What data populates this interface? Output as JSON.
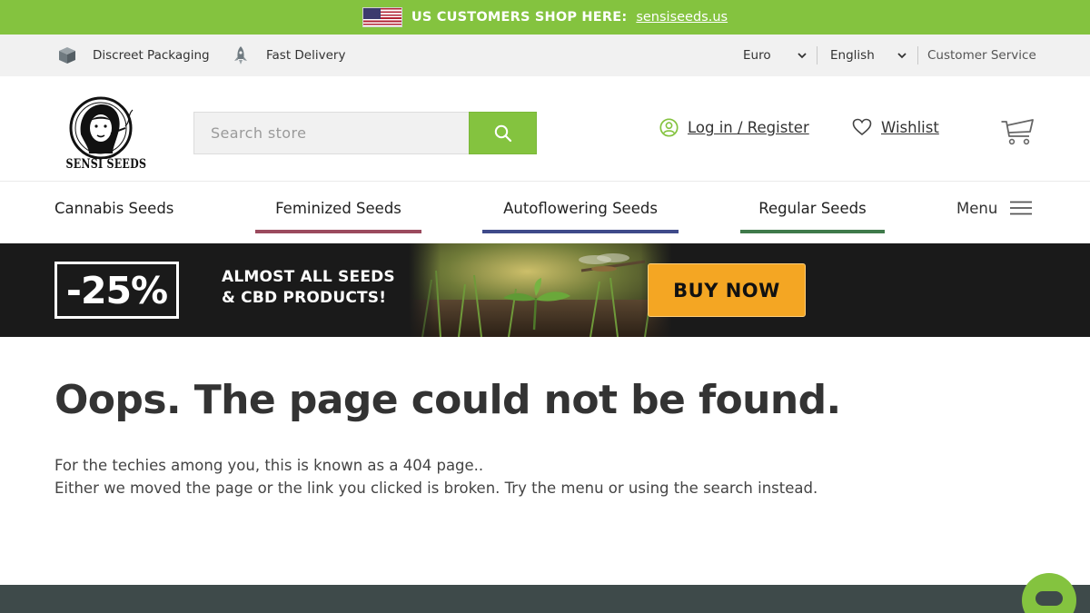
{
  "top_banner": {
    "text": "US CUSTOMERS SHOP HERE:",
    "link": "sensiseeds.us",
    "flag_icon": "us-flag-icon",
    "bg_color": "#84c33f"
  },
  "util_bar": {
    "packaging": "Discreet Packaging",
    "delivery": "Fast Delivery",
    "currency": "Euro",
    "language": "English",
    "customer_service": "Customer Service"
  },
  "header": {
    "logo_text": "SENSI SEEDS",
    "search_placeholder": "Search store",
    "login": "Log in / Register",
    "wishlist": "Wishlist"
  },
  "categories": [
    {
      "label": "Cannabis Seeds",
      "color": ""
    },
    {
      "label": "Feminized Seeds",
      "color": "#9b4a5e"
    },
    {
      "label": "Autoflowering Seeds",
      "color": "#3f4a8a"
    },
    {
      "label": "Regular Seeds",
      "color": "#3f7a4a"
    }
  ],
  "menu_label": "Menu",
  "promo": {
    "discount": "-25%",
    "line1": "ALMOST ALL SEEDS",
    "line2": "& CBD PRODUCTS!",
    "button": "BUY NOW",
    "button_color": "#f4a623"
  },
  "error_page": {
    "title": "Oops. The page could not be found.",
    "line1": "For the techies among you, this is known as a 404 page..",
    "line2": "Either we moved the page or the link you clicked is broken. Try the menu or using the search instead."
  },
  "colors": {
    "brand_green": "#84c33f",
    "footer": "#3e4a4a"
  }
}
